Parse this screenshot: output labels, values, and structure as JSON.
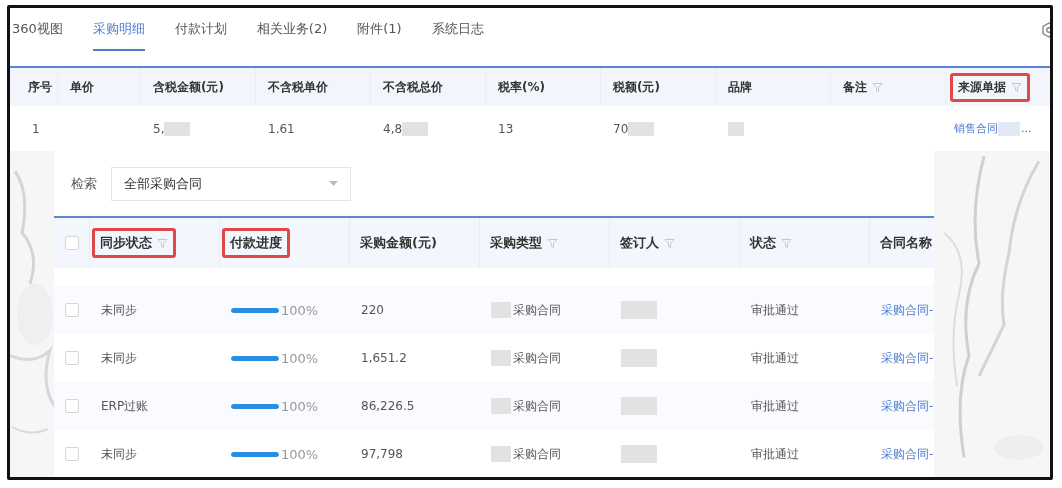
{
  "tabs": [
    {
      "label": "360视图",
      "selected": false
    },
    {
      "label": "采购明细",
      "selected": true
    },
    {
      "label": "付款计划",
      "selected": false
    },
    {
      "label": "相关业务(2)",
      "selected": false
    },
    {
      "label": "附件(1)",
      "selected": false
    },
    {
      "label": "系统日志",
      "selected": false
    }
  ],
  "main_table": {
    "columns": [
      {
        "label": "序号",
        "filter": false,
        "highlighted": false
      },
      {
        "label": "单价",
        "filter": false,
        "highlighted": false
      },
      {
        "label": "含税金额(元)",
        "filter": false,
        "highlighted": false
      },
      {
        "label": "不含税单价",
        "filter": false,
        "highlighted": false
      },
      {
        "label": "不含税总价",
        "filter": false,
        "highlighted": false
      },
      {
        "label": "税率(%)",
        "filter": false,
        "highlighted": false
      },
      {
        "label": "税额(元)",
        "filter": false,
        "highlighted": false
      },
      {
        "label": "品牌",
        "filter": false,
        "highlighted": false
      },
      {
        "label": "备注",
        "filter": true,
        "highlighted": false
      },
      {
        "label": "来源单据",
        "filter": true,
        "highlighted": true
      }
    ],
    "rows": [
      {
        "cells": [
          {
            "kind": "text",
            "text": "1",
            "blur": false
          },
          {
            "kind": "blank"
          },
          {
            "kind": "text",
            "text": "5,",
            "blur": true
          },
          {
            "kind": "text",
            "text": "1.61",
            "blur": false
          },
          {
            "kind": "text",
            "text": "4,8",
            "blur": true
          },
          {
            "kind": "text",
            "text": "13",
            "blur": false
          },
          {
            "kind": "text",
            "text": "70",
            "blur": true
          },
          {
            "kind": "blur"
          },
          {
            "kind": "blank"
          },
          {
            "kind": "link",
            "text": "销售合同",
            "blur": true,
            "suffix": "..."
          }
        ]
      }
    ]
  },
  "search": {
    "label": "检索",
    "value": "全部采购合同"
  },
  "contracts_table": {
    "all_checked": false,
    "columns": [
      {
        "kind": "sync",
        "label": "同步状态",
        "filter": true,
        "highlighted": true
      },
      {
        "kind": "progress",
        "label": "付款进度",
        "filter": false,
        "highlighted": true
      },
      {
        "kind": "amount",
        "label": "采购金额(元)",
        "filter": false,
        "highlighted": false
      },
      {
        "kind": "type",
        "label": "采购类型",
        "filter": true,
        "highlighted": false
      },
      {
        "kind": "signer",
        "label": "签订人",
        "filter": true,
        "highlighted": false
      },
      {
        "kind": "status",
        "label": "状态",
        "filter": true,
        "highlighted": false
      },
      {
        "kind": "name",
        "label": "合同名称",
        "filter": false,
        "highlighted": false
      }
    ],
    "rows": [
      {
        "checked": false,
        "sync": "未同步",
        "level": 1,
        "reading": "100%",
        "amount": "220",
        "type": "采购合同",
        "status": "审批通过",
        "name": "采购合同-"
      },
      {
        "checked": false,
        "sync": "未同步",
        "level": 1,
        "reading": "100%",
        "amount": "1,651.2",
        "type": "采购合同",
        "status": "审批通过",
        "name": "采购合同-"
      },
      {
        "checked": false,
        "sync": "ERP过账",
        "level": 1,
        "reading": "100%",
        "amount": "86,226.5",
        "type": "采购合同",
        "status": "审批通过",
        "name": "采购合同-"
      },
      {
        "checked": false,
        "sync": "未同步",
        "level": 1,
        "reading": "100%",
        "amount": "97,798",
        "type": "采购合同",
        "status": "审批通过",
        "name": "采购合同-"
      }
    ]
  }
}
